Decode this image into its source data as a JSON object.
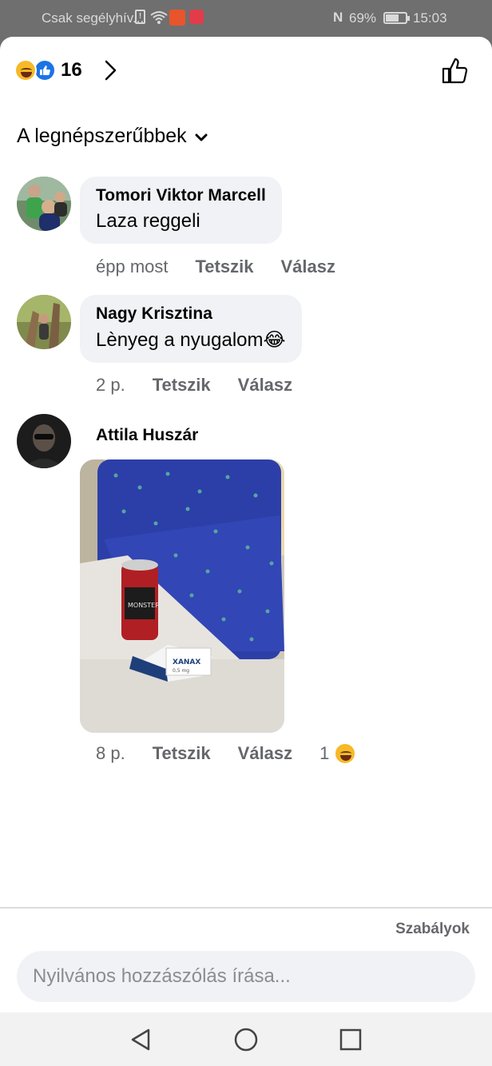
{
  "status_bar": {
    "carrier": "Csak segélyhív...",
    "battery": "69%",
    "time": "15:03"
  },
  "header": {
    "reaction_count": "16",
    "reaction_icons": [
      "haha-icon",
      "like-icon"
    ]
  },
  "sort": {
    "label": "A legnépszerűbbek"
  },
  "comments": [
    {
      "author": "Tomori Viktor Marcell",
      "text": "Laza reggeli",
      "time": "épp most",
      "like": "Tetszik",
      "reply": "Válasz"
    },
    {
      "author": "Nagy Krisztina",
      "text": "Lènyeg a nyugalom",
      "text_emoji": "😂",
      "time": "2 p.",
      "like": "Tetszik",
      "reply": "Válasz"
    },
    {
      "author": "Attila Huszár",
      "photo": {
        "can_text": "MONSTER",
        "box_text": "XANAX",
        "box_subtext": "0,5 mg"
      },
      "time": "8 p.",
      "like": "Tetszik",
      "reply": "Válasz",
      "reactions": "1"
    }
  ],
  "footer": {
    "rules": "Szabályok",
    "composer_placeholder": "Nyilvános hozzászólás írása..."
  },
  "colors": {
    "bubble": "#f0f2f5",
    "meta_text": "#65676b",
    "like_blue": "#1b74e4",
    "haha_yellow": "#f7b928"
  }
}
